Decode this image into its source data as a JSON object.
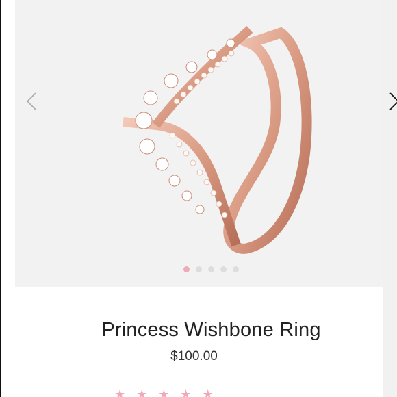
{
  "product": {
    "name": "Princess Wishbone Ring",
    "price": "$100.00"
  },
  "gallery": {
    "image_icon": "rose-gold-wishbone-ring",
    "prev_icon": "chevron-left-icon",
    "next_icon": "chevron-right-icon",
    "slides": 5,
    "active_slide": 1,
    "active_dot_color": "#eeaab7",
    "inactive_dot_color": "#dddddd"
  },
  "rating": {
    "star_icon": "star-icon",
    "star_color": "#f1a8b7",
    "stars_visible": 5
  }
}
